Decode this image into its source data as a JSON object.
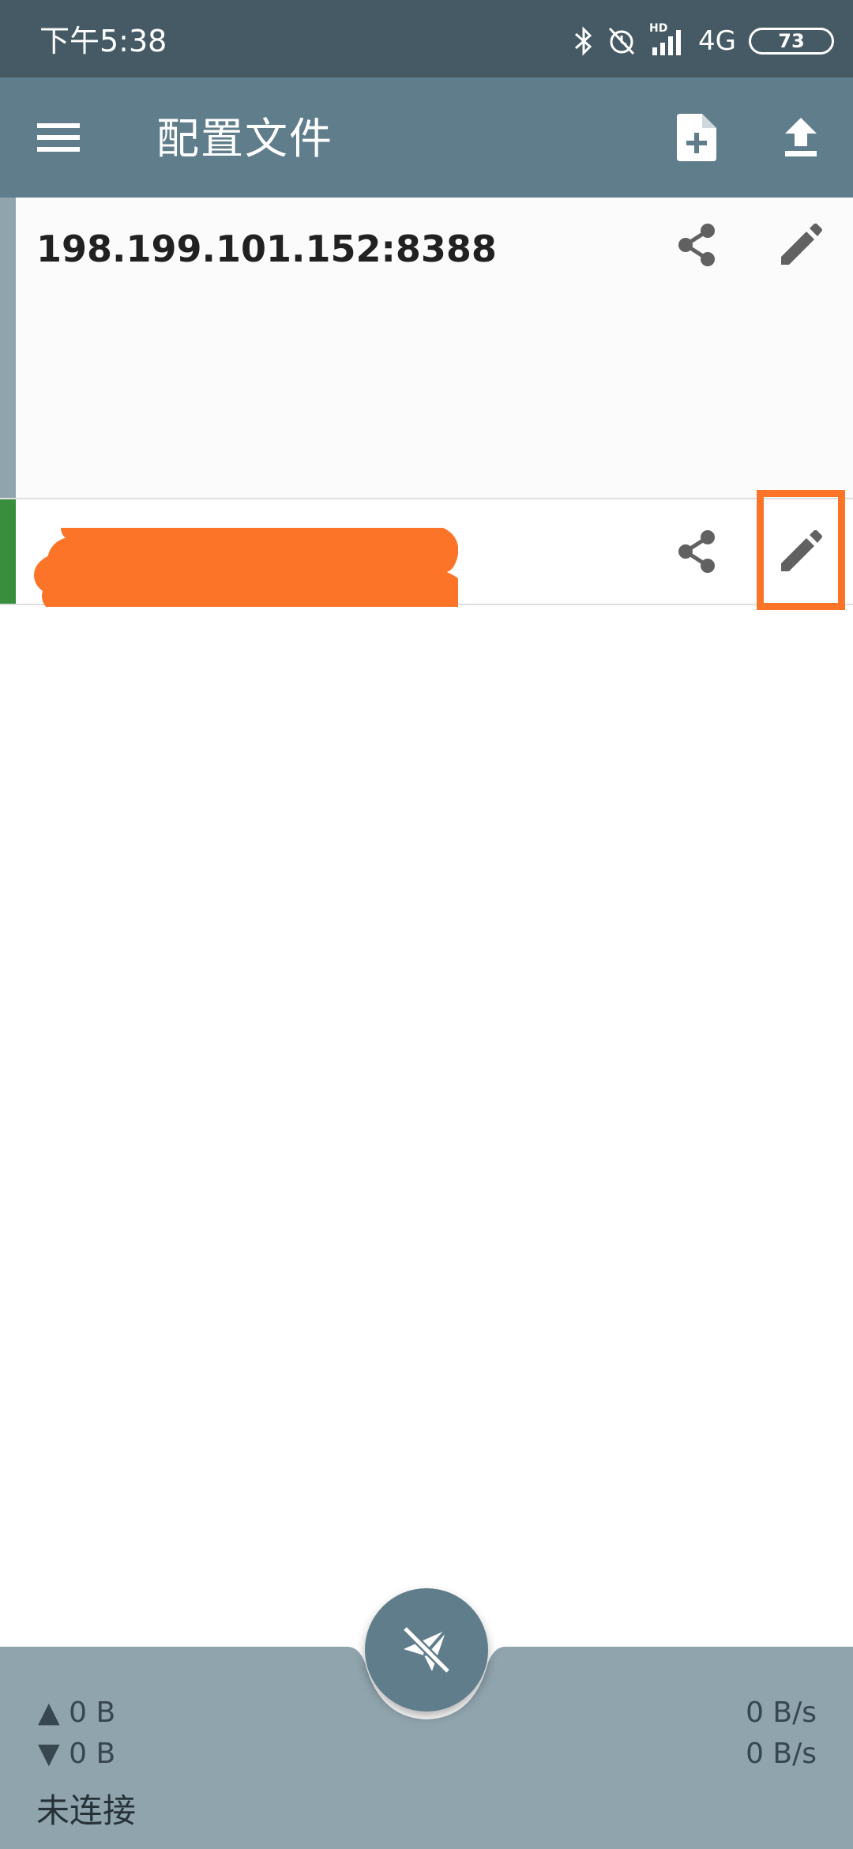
{
  "status_bar": {
    "time": "下午5:38",
    "network": "4G",
    "hd_badge": "HD",
    "battery": "73",
    "icons": [
      "bluetooth-icon",
      "alarm-off-icon",
      "signal-icon",
      "battery-icon"
    ]
  },
  "app_bar": {
    "title": "配置文件",
    "icons": [
      "menu-icon",
      "new-file-icon",
      "upload-icon"
    ]
  },
  "profiles": [
    {
      "name": "198.199.101.152:8388",
      "selected": false,
      "accent": "#90a4ae"
    },
    {
      "name": "",
      "selected": true,
      "accent": "#388e3c",
      "redacted": true
    }
  ],
  "stats": {
    "tx_total": "▲ 0 B",
    "rx_total": "▼ 0 B",
    "tx_rate": "0 B/s",
    "rx_rate": "0 B/s",
    "status": "未连接"
  },
  "colors": {
    "status_bar": "#455a64",
    "app_bar": "#607d8b",
    "stats_bar": "#90a4ae",
    "highlight": "#fb7428",
    "active_profile": "#388e3c"
  }
}
